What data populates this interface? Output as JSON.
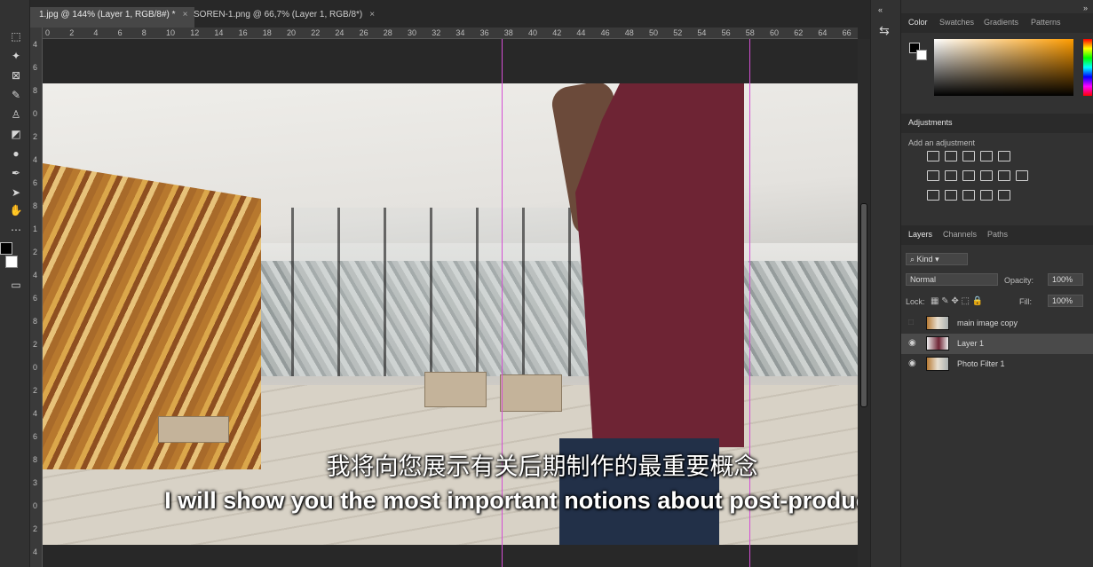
{
  "tabs": [
    {
      "label": "1.jpg @ 144% (Layer 1, RGB/8#) *",
      "close": "×"
    },
    {
      "label": "SOREN-1.png @ 66,7% (Layer 1, RGB/8*)",
      "close": "×"
    }
  ],
  "ruler_h": [
    "0",
    "2",
    "4",
    "6",
    "8",
    "10",
    "12",
    "14",
    "16",
    "18",
    "20",
    "22",
    "24",
    "26",
    "28",
    "30",
    "32",
    "34",
    "36",
    "38",
    "40",
    "42",
    "44",
    "46",
    "48",
    "50",
    "52",
    "54",
    "56",
    "58",
    "60",
    "62",
    "64",
    "66"
  ],
  "ruler_v": [
    "4",
    "6",
    "8",
    "0",
    "2",
    "4",
    "6",
    "8",
    "1",
    "2",
    "4",
    "6",
    "8",
    "2",
    "0",
    "2",
    "4",
    "6",
    "8",
    "3",
    "0",
    "2",
    "4"
  ],
  "subtitles": {
    "chinese": "我将向您展示有关后期制作的最重要概念",
    "english": "I will show you the most important notions about post-production."
  },
  "color_panel": {
    "tabs": [
      "Color",
      "Swatches",
      "Gradients",
      "Patterns"
    ]
  },
  "adjustments": {
    "title": "Adjustments",
    "hint": "Add an adjustment"
  },
  "layers_panel": {
    "tabs": [
      "Layers",
      "Channels",
      "Paths"
    ],
    "kind": "Kind",
    "blend_mode": "Normal",
    "opacity_label": "Opacity:",
    "opacity_value": "100%",
    "lock_label": "Lock:",
    "fill_label": "Fill:",
    "fill_value": "100%",
    "layers": [
      {
        "name": "main image copy",
        "visible": false,
        "selected": false
      },
      {
        "name": "Layer 1",
        "visible": true,
        "selected": true
      },
      {
        "name": "Photo Filter 1",
        "visible": true,
        "selected": false
      }
    ]
  },
  "colors": {
    "guide": "#d44fd4",
    "shirt": "#6e2434"
  }
}
